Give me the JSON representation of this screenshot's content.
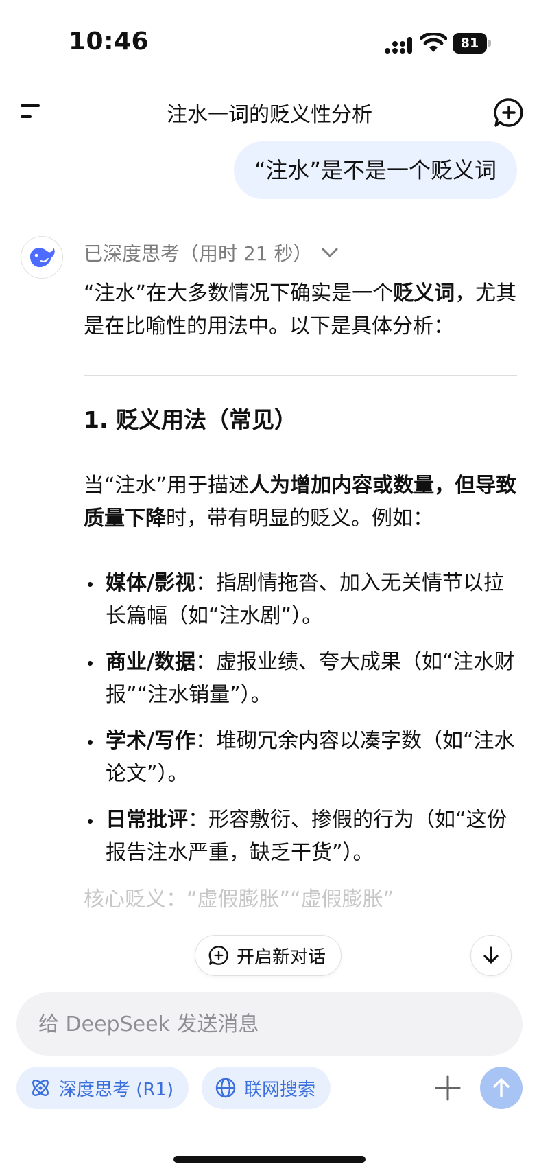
{
  "status_bar": {
    "time": "10:46",
    "battery": "81",
    "icons": [
      "signal-icon",
      "wifi-icon",
      "battery-icon"
    ]
  },
  "header": {
    "title": "注水一词的贬义性分析",
    "icons": [
      "menu-icon",
      "new-chat-icon"
    ]
  },
  "user_message": "“注水”是不是一个贬义词",
  "assistant": {
    "avatar_icon": "whale-icon",
    "thinking_label": "已深度思考（用时 21 秒）",
    "intro": {
      "p1": "“注水”在大多数情况下确实是一个",
      "b1": "贬义词",
      "p2": "，尤其是在比喻性的用法中。以下是具体分析："
    },
    "section_title": "1. 贬义用法（常见）",
    "para": {
      "p1": "当“注水”用于描述",
      "b1": "人为增加内容或数量，但导致质量下降",
      "p2": "时，带有明显的贬义。例如："
    },
    "bullets": [
      {
        "term": "媒体/影视",
        "text": "：指剧情拖沓、加入无关情节以拉长篇幅（如“注水剧”）。"
      },
      {
        "term": "商业/数据",
        "text": "：虚报业绩、夸大成果（如“注水财报”“注水销量”）。"
      },
      {
        "term": "学术/写作",
        "text": "：堆砌冗余内容以凑字数（如“注水论文”）。"
      },
      {
        "term": "日常批评",
        "text": "：形容敷衍、掺假的行为（如“这份报告注水严重，缺乏干货”）。"
      }
    ],
    "faded_text": "核心贬义：“虚假膨胀”“虚假膨胀”"
  },
  "floating": {
    "new_dialog_label": "开启新对话"
  },
  "input": {
    "placeholder": "给 DeepSeek 发送消息",
    "value": ""
  },
  "toolbar": {
    "deepthink_label": "深度思考 (R1)",
    "search_label": "联网搜索"
  },
  "colors": {
    "accent": "#3a6fdc",
    "pill_bg": "#e9f0fd",
    "user_bubble_bg": "#eaf1ff",
    "send_button": "#a8c4f5"
  }
}
